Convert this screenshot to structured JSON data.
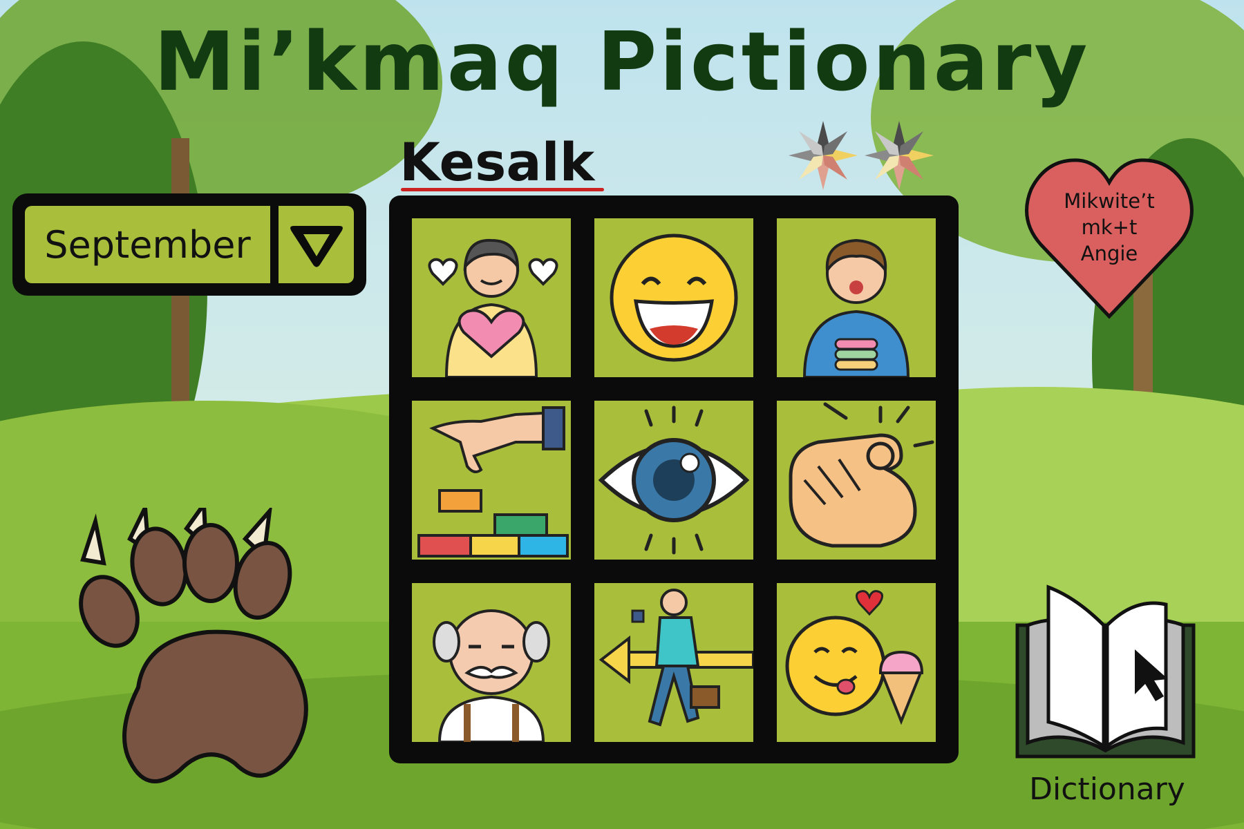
{
  "title": "Mi’kmaq Pictionary",
  "word": "Kesalk",
  "month_selector": {
    "value": "September"
  },
  "credit": {
    "line1": "Mikwite’t",
    "line2": "mk+t",
    "line3": "Angie"
  },
  "dictionary": {
    "label": "Dictionary"
  },
  "grid": {
    "cells": [
      {
        "icon": "person-hugging-heart-icon"
      },
      {
        "icon": "grinning-face-icon"
      },
      {
        "icon": "person-eating-macarons-icon"
      },
      {
        "icon": "hand-placing-blocks-icon"
      },
      {
        "icon": "eye-icon"
      },
      {
        "icon": "pointing-finger-icon"
      },
      {
        "icon": "old-man-icon"
      },
      {
        "icon": "woman-walking-back-icon"
      },
      {
        "icon": "yummy-face-ice-cream-icon"
      }
    ]
  },
  "colors": {
    "title": "#123b12",
    "cell": "#a9be3a",
    "board": "#0b0b0b",
    "heart": "#d9605f",
    "underline": "#cc2222",
    "paw": "#7a5443"
  }
}
